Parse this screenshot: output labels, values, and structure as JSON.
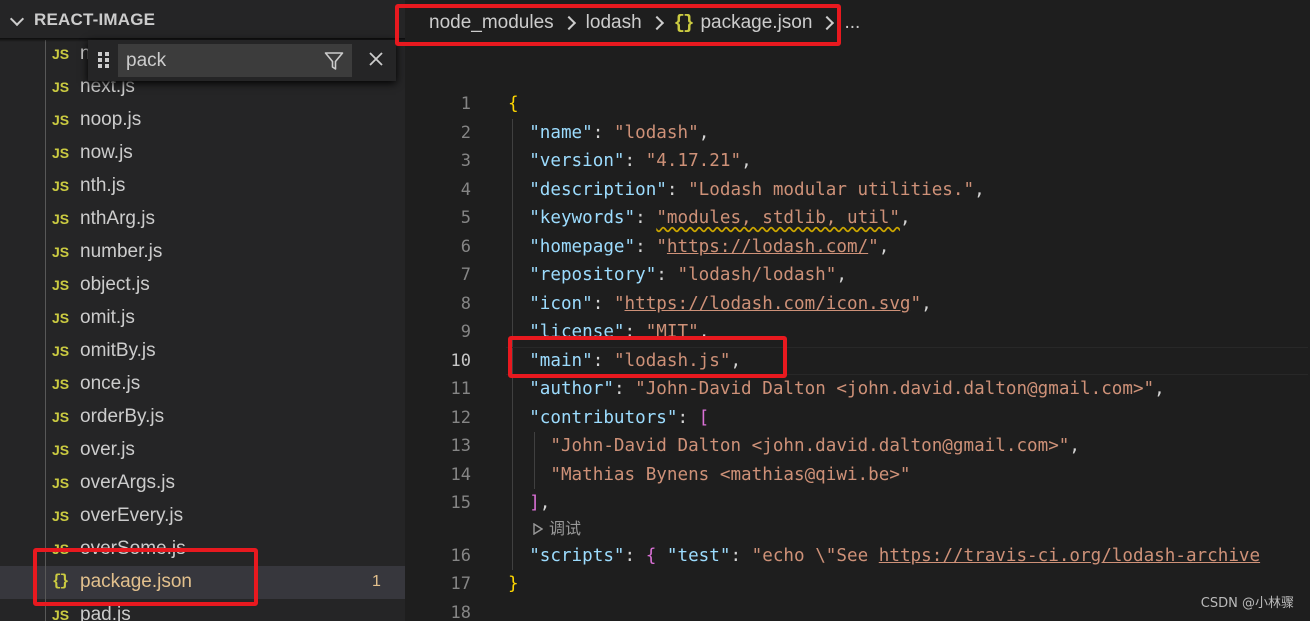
{
  "explorer": {
    "title": "REACT-IMAGE",
    "filter": {
      "value": "pack"
    },
    "files": [
      {
        "name": "n",
        "icon": "JS"
      },
      {
        "name": "next.js",
        "icon": "JS"
      },
      {
        "name": "noop.js",
        "icon": "JS"
      },
      {
        "name": "now.js",
        "icon": "JS"
      },
      {
        "name": "nth.js",
        "icon": "JS"
      },
      {
        "name": "nthArg.js",
        "icon": "JS"
      },
      {
        "name": "number.js",
        "icon": "JS"
      },
      {
        "name": "object.js",
        "icon": "JS"
      },
      {
        "name": "omit.js",
        "icon": "JS"
      },
      {
        "name": "omitBy.js",
        "icon": "JS"
      },
      {
        "name": "once.js",
        "icon": "JS"
      },
      {
        "name": "orderBy.js",
        "icon": "JS"
      },
      {
        "name": "over.js",
        "icon": "JS"
      },
      {
        "name": "overArgs.js",
        "icon": "JS"
      },
      {
        "name": "overEvery.js",
        "icon": "JS"
      },
      {
        "name": "overSome.js",
        "icon": "JS"
      },
      {
        "name": "package.json",
        "icon": "{}",
        "badge": "1"
      },
      {
        "name": "pad.js",
        "icon": "JS"
      }
    ]
  },
  "breadcrumb": {
    "items": [
      "node_modules",
      "lodash",
      "package.json"
    ],
    "json_icon": "{}",
    "more": "..."
  },
  "editor": {
    "line_numbers": [
      "1",
      "2",
      "3",
      "4",
      "5",
      "6",
      "7",
      "8",
      "9",
      "10",
      "11",
      "12",
      "13",
      "14",
      "15",
      "16",
      "17",
      "18"
    ],
    "active_line": "10",
    "codelens": "调试",
    "code": {
      "l1_open": "{",
      "name_k": "\"name\"",
      "name_v": "\"lodash\"",
      "version_k": "\"version\"",
      "version_v": "\"4.17.21\"",
      "desc_k": "\"description\"",
      "desc_v": "\"Lodash modular utilities.\"",
      "kw_k": "\"keywords\"",
      "kw_v": "\"modules, stdlib, util\"",
      "hp_k": "\"homepage\"",
      "hp_q1": "\"",
      "hp_url": "https://lodash.com/",
      "hp_q2": "\"",
      "repo_k": "\"repository\"",
      "repo_v": "\"lodash/lodash\"",
      "icon_k": "\"icon\"",
      "icon_q1": "\"",
      "icon_url": "https://lodash.com/icon.svg",
      "icon_q2": "\"",
      "lic_k": "\"license\"",
      "lic_v": "\"MIT\"",
      "main_k": "\"main\"",
      "main_v": "\"lodash.js\"",
      "author_k": "\"author\"",
      "author_v": "\"John-David Dalton <john.david.dalton@gmail.com>\"",
      "contrib_k": "\"contributors\"",
      "contrib_open": "[",
      "contrib_1": "\"John-David Dalton <john.david.dalton@gmail.com>\"",
      "contrib_2": "\"Mathias Bynens <mathias@qiwi.be>\"",
      "contrib_close": "]",
      "scripts_k": "\"scripts\"",
      "scripts_open": "{",
      "test_k": "\"test\"",
      "test_v1": "\"echo \\\"See ",
      "test_url": "https://travis-ci.org/lodash-archive",
      "l17_close": "}"
    }
  },
  "watermark": "CSDN @小林骤",
  "colors": {
    "highlight_box": "#e8191f",
    "js_icon": "#cbcb41",
    "modified": "#e2c08d"
  }
}
